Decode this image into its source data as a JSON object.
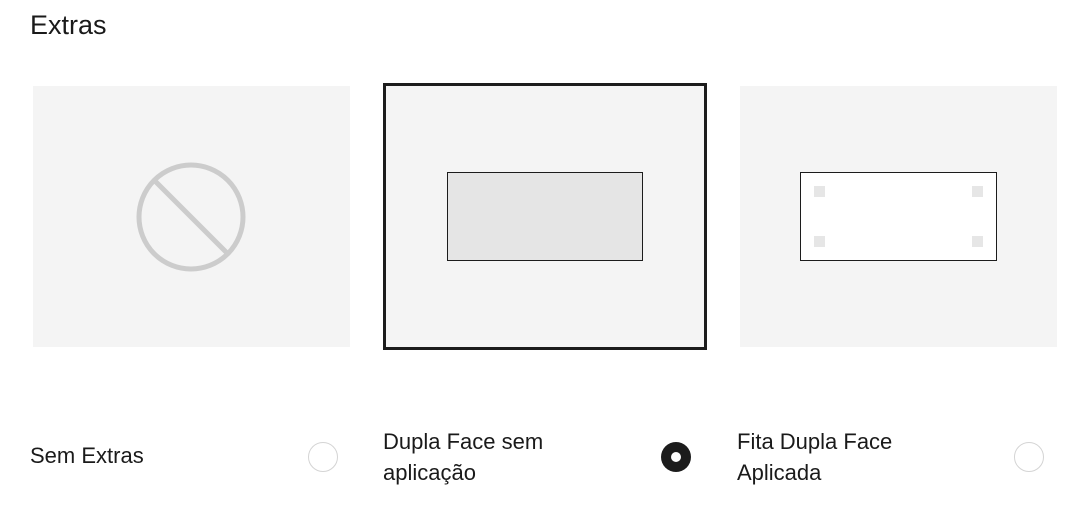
{
  "section": {
    "title": "Extras"
  },
  "options": [
    {
      "label": "Sem Extras",
      "icon": "prohibited-icon",
      "selected": false
    },
    {
      "label": "Dupla Face sem aplicação",
      "icon": "tape-unapplied-icon",
      "selected": true
    },
    {
      "label": "Fita Dupla Face Aplicada",
      "icon": "tape-applied-icon",
      "selected": false
    }
  ],
  "colors": {
    "background": "#ffffff",
    "thumbnail": "#f4f4f4",
    "selected_border": "#1c1c1c",
    "radio_border": "#d4d4d4",
    "icon_gray": "#cccccc"
  }
}
